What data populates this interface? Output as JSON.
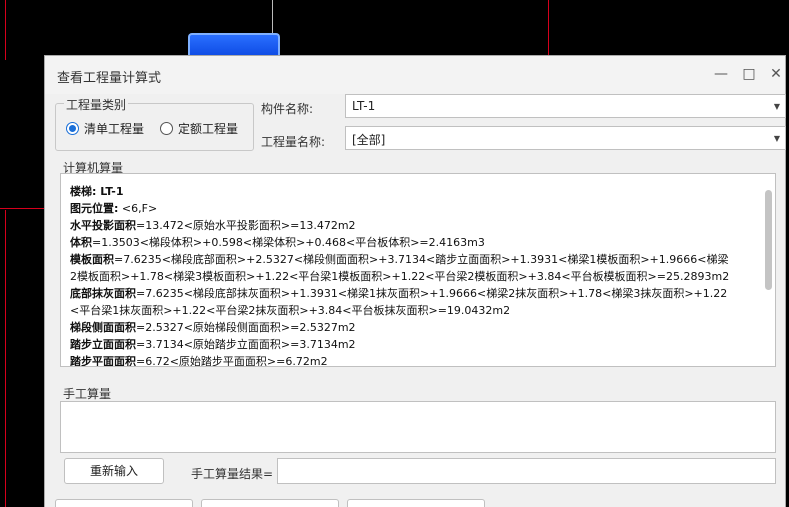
{
  "dialog": {
    "title": "查看工程量计算式",
    "minimize_icon": "minimize-icon",
    "maximize_icon": "maximize-icon",
    "close_icon": "close-icon"
  },
  "quantity_category": {
    "legend": "工程量类别",
    "options": [
      {
        "label": "清单工程量",
        "selected": true
      },
      {
        "label": "定额工程量",
        "selected": false
      }
    ]
  },
  "component_name": {
    "label": "构件名称:",
    "value": "LT-1"
  },
  "quantity_name": {
    "label": "工程量名称:",
    "value": "[全部]"
  },
  "computer_calc": {
    "legend": "计算机算量",
    "lines": [
      {
        "bold": "楼梯: LT-1",
        "text": ""
      },
      {
        "bold": "图元位置:",
        "text": " <6,F>"
      },
      {
        "bold": "水平投影面积",
        "text": "=13.472<原始水平投影面积>=13.472m2"
      },
      {
        "bold": "体积",
        "text": "=1.3503<梯段体积>+0.598<梯梁体积>+0.468<平台板体积>=2.4163m3"
      },
      {
        "bold": "模板面积",
        "text": "=7.6235<梯段底部面积>+2.5327<梯段侧面面积>+3.7134<踏步立面面积>+1.3931<梯梁1模板面积>+1.9666<梯梁"
      },
      {
        "bold": "",
        "text": "2模板面积>+1.78<梯梁3模板面积>+1.22<平台梁1模板面积>+1.22<平台梁2模板面积>+3.84<平台板模板面积>=25.2893m2"
      },
      {
        "bold": "底部抹灰面积",
        "text": "=7.6235<梯段底部抹灰面积>+1.3931<梯梁1抹灰面积>+1.9666<梯梁2抹灰面积>+1.78<梯梁3抹灰面积>+1.22"
      },
      {
        "bold": "",
        "text": "<平台梁1抹灰面积>+1.22<平台梁2抹灰面积>+3.84<平台板抹灰面积>=19.0432m2"
      },
      {
        "bold": "梯段侧面面积",
        "text": "=2.5327<原始梯段侧面面积>=2.5327m2"
      },
      {
        "bold": "踏步立面面积",
        "text": "=3.7134<原始踏步立面面积>=3.7134m2"
      },
      {
        "bold": "踏步平面面积",
        "text": "=6.72<原始踏步平面面积>=6.72m2"
      }
    ]
  },
  "manual_calc": {
    "legend": "手工算量",
    "reset_label": "重新输入",
    "result_label": "手工算量结果="
  }
}
